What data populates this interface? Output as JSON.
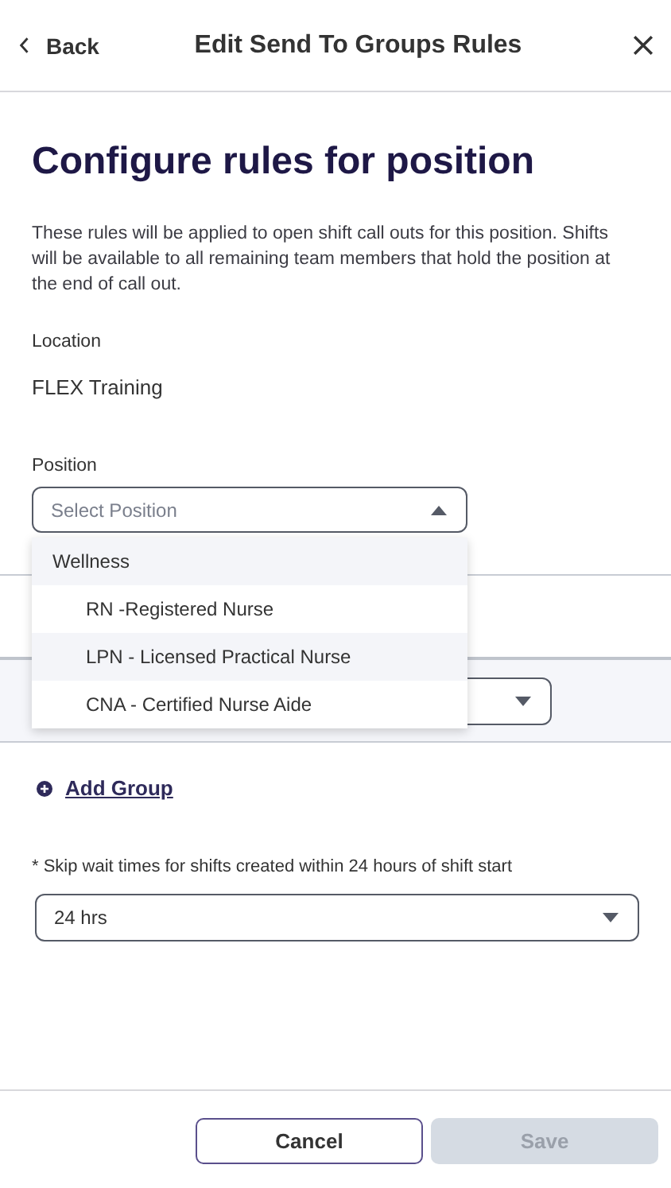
{
  "header": {
    "back": "Back",
    "title": "Edit Send To Groups Rules"
  },
  "heading": "Configure rules for position",
  "description": "These rules will be applied to open shift call outs for this position. Shifts will be available to all remaining team members that hold the position at the end of call out.",
  "location": {
    "label": "Location",
    "value": "FLEX Training"
  },
  "position": {
    "label": "Position",
    "placeholder": "Select Position",
    "expanded": true,
    "options": [
      {
        "kind": "group",
        "label": "Wellness",
        "highlighted": true
      },
      {
        "kind": "option",
        "label": "RN -Registered Nurse",
        "highlighted": false
      },
      {
        "kind": "option",
        "label": "LPN - Licensed Practical Nurse",
        "highlighted": true
      },
      {
        "kind": "option",
        "label": "CNA - Certified Nurse Aide",
        "highlighted": false
      }
    ]
  },
  "add_group": "Add Group",
  "skip_wait": {
    "label": "* Skip wait times for shifts created within 24 hours of shift start",
    "value": "24 hrs"
  },
  "buttons": [
    {
      "label": "Cancel",
      "kind": "secondary",
      "disabled": false
    },
    {
      "label": "Save",
      "kind": "primary",
      "disabled": true
    }
  ]
}
